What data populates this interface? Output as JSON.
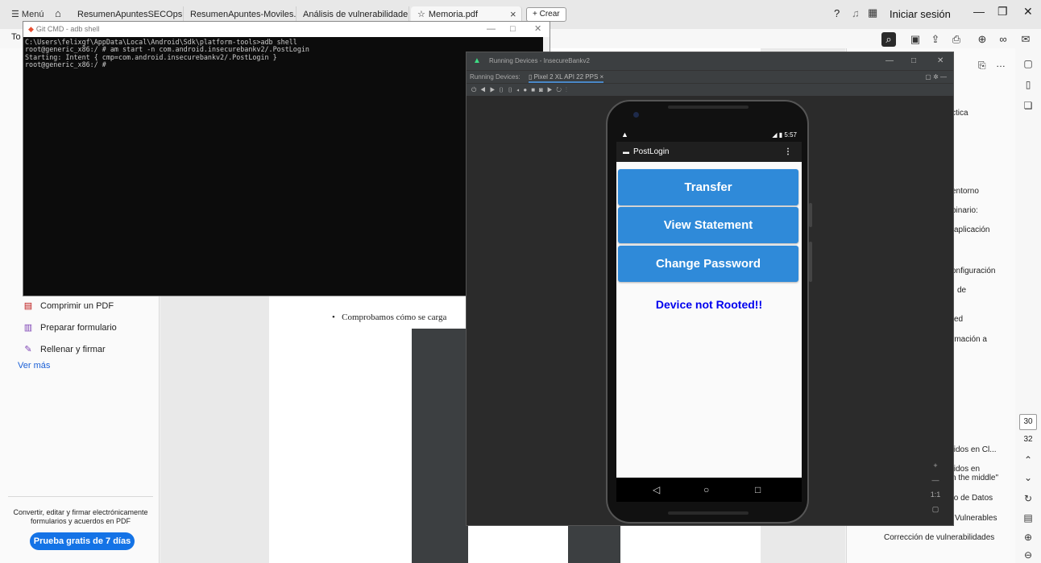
{
  "browser": {
    "menu_label": "☰ Menú",
    "tabs": [
      {
        "label": "ResumenApuntesSECOps..."
      },
      {
        "label": "ResumenApuntes-Moviles..."
      },
      {
        "label": "Análisis de vulnerabilidade..."
      },
      {
        "label": "Memoria.pdf"
      }
    ],
    "new_tab_label": "+ Crear",
    "signin_label": "Iniciar sesión"
  },
  "pdf_toolbar": {
    "tools_label": "To"
  },
  "left_panel": {
    "items": [
      {
        "label": "Comprimir un PDF"
      },
      {
        "label": "Preparar formulario"
      },
      {
        "label": "Rellenar y firmar"
      }
    ],
    "ver_mas": "Ver más",
    "promo_text": "Convertir, editar y firmar electrónicamente formularios y acuerdos en PDF",
    "promo_button": "Prueba gratis de 7 días"
  },
  "document": {
    "bullet_text": "Comprobamos cómo se carga"
  },
  "outline": {
    "items": [
      {
        "label": "ctica"
      },
      {
        "label": "entorno"
      },
      {
        "label": "binario:"
      },
      {
        "label": "aplicación"
      },
      {
        "label": "onfiguración"
      },
      {
        "label": "de"
      },
      {
        "label": "ed"
      },
      {
        "label": "rmación a"
      },
      {
        "label": "tidos en Cl..."
      },
      {
        "label": "tidos en"
      },
      {
        "label": "n the middle\""
      },
      {
        "label": "to de Datos"
      },
      {
        "label": "Vulnerables"
      },
      {
        "label": "Corrección de vulnerabilidades"
      }
    ],
    "page_current": "30",
    "page_total": "32"
  },
  "cmd": {
    "title": "Git CMD - adb shell",
    "lines": [
      "C:\\Users\\felixgf\\AppData\\Local\\Android\\Sdk\\platform-tools>adb shell",
      "root@generic_x86:/ # am start -n com.android.insecurebankv2/.PostLogin",
      "Starting: Intent { cmp=com.android.insecurebankv2/.PostLogin }",
      "root@generic_x86:/ #"
    ]
  },
  "emulator": {
    "title": "Running Devices - InsecureBankv2",
    "tabs_label": "Running Devices:",
    "device_tab": "Pixel 2 XL API 22 PPS",
    "zoom_label": "1:1"
  },
  "phone": {
    "time": "5:57",
    "app_title": "PostLogin",
    "buttons": [
      {
        "label": "Transfer"
      },
      {
        "label": "View Statement"
      },
      {
        "label": "Change Password"
      }
    ],
    "status_message": "Device not Rooted!!"
  },
  "colors": {
    "app_button": "#2f8ad9",
    "rooted_text": "#0000ee",
    "promo_button": "#1473e6"
  }
}
